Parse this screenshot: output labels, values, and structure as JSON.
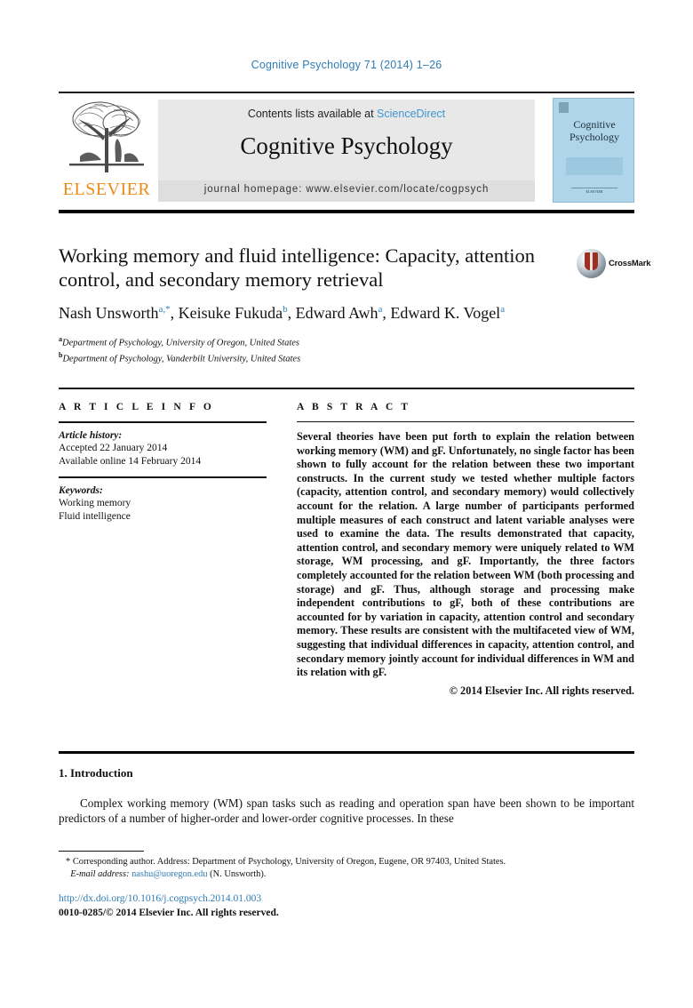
{
  "running_head": "Cognitive Psychology 71 (2014) 1–26",
  "masthead": {
    "publisher_name": "ELSEVIER",
    "contents_prefix": "Contents lists available at ",
    "contents_link": "ScienceDirect",
    "journal_title": "Cognitive Psychology",
    "homepage": "journal homepage: www.elsevier.com/locate/cogpsych",
    "cover_title": "Cognitive Psychology",
    "cover_footer": "ELSEVIER"
  },
  "article": {
    "title": "Working memory and fluid intelligence: Capacity, attention control, and secondary memory retrieval",
    "crossmark_label": "CrossMark",
    "authors": [
      {
        "name": "Nash Unsworth",
        "marks": "a,*"
      },
      {
        "name": "Keisuke Fukuda",
        "marks": "b"
      },
      {
        "name": "Edward Awh",
        "marks": "a"
      },
      {
        "name": "Edward K. Vogel",
        "marks": "a"
      }
    ],
    "affiliations": [
      {
        "mark": "a",
        "text": "Department of Psychology, University of Oregon, United States"
      },
      {
        "mark": "b",
        "text": "Department of Psychology, Vanderbilt University, United States"
      }
    ]
  },
  "article_info": {
    "heading": "A R T I C L E  I N F O",
    "history_label": "Article history:",
    "history_lines": [
      "Accepted 22 January 2014",
      "Available online 14 February 2014"
    ],
    "keywords_label": "Keywords:",
    "keywords": [
      "Working memory",
      "Fluid intelligence"
    ]
  },
  "abstract": {
    "heading": "A B S T R A C T",
    "body": "Several theories have been put forth to explain the relation between working memory (WM) and gF. Unfortunately, no single factor has been shown to fully account for the relation between these two important constructs. In the current study we tested whether multiple factors (capacity, attention control, and secondary memory) would collectively account for the relation. A large number of participants performed multiple measures of each construct and latent variable analyses were used to examine the data. The results demonstrated that capacity, attention control, and secondary memory were uniquely related to WM storage, WM processing, and gF. Importantly, the three factors completely accounted for the relation between WM (both processing and storage) and gF. Thus, although storage and processing make independent contributions to gF, both of these contributions are accounted for by variation in capacity, attention control and secondary memory. These results are consistent with the multifaceted view of WM, suggesting that individual differences in capacity, attention control, and secondary memory jointly account for individual differences in WM and its relation with gF.",
    "copyright": "© 2014 Elsevier Inc. All rights reserved."
  },
  "introduction": {
    "heading": "1. Introduction",
    "paragraph": "Complex working memory (WM) span tasks such as reading and operation span have been shown to be important predictors of a number of higher-order and lower-order cognitive processes. In these"
  },
  "footer": {
    "corresponding_marker": "*",
    "corresponding_text": "Corresponding author. Address: Department of Psychology, University of Oregon, Eugene, OR 97403, United States.",
    "email_label": "E-mail address:",
    "email": "nashu@uoregon.edu",
    "email_owner": "(N. Unsworth).",
    "doi": "http://dx.doi.org/10.1016/j.cogpsych.2014.01.003",
    "issn_line": "0010-0285/© 2014 Elsevier Inc. All rights reserved."
  },
  "colors": {
    "link_blue": "#2e7db5",
    "sciencedirect_blue": "#3e96d1",
    "elsevier_orange": "#ed8b19",
    "cover_blue": "#aed5ea"
  }
}
